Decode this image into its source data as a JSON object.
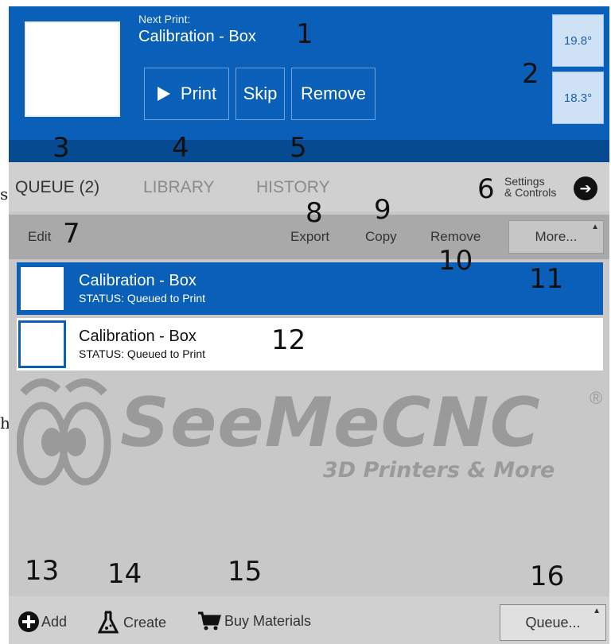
{
  "stray_glyphs": [
    "s",
    "h"
  ],
  "header": {
    "next_label": "Next Print:",
    "next_title": "Calibration - Box",
    "print_label": "Print",
    "skip_label": "Skip",
    "remove_label": "Remove",
    "temps": [
      "19.8°",
      "18.3°"
    ]
  },
  "tabs": {
    "queue": "QUEUE (2)",
    "library": "LIBRARY",
    "history": "HISTORY",
    "settings_line1": "Settings",
    "settings_line2": "& Controls"
  },
  "toolbar": {
    "edit": "Edit",
    "export": "Export",
    "copy": "Copy",
    "remove": "Remove",
    "more": "More..."
  },
  "queue": {
    "items": [
      {
        "title": "Calibration - Box",
        "status": "STATUS: Queued to Print",
        "selected": true
      },
      {
        "title": "Calibration - Box",
        "status": "STATUS: Queued to Print",
        "selected": false
      }
    ]
  },
  "logo": {
    "name": "SeeMeCNC",
    "reg": "®",
    "tagline": "3D Printers & More"
  },
  "bottom": {
    "add": "Add",
    "create": "Create",
    "buy": "Buy Materials",
    "queue_btn": "Queue..."
  },
  "callouts": [
    "1",
    "2",
    "3",
    "4",
    "5",
    "6",
    "7",
    "8",
    "9",
    "10",
    "11",
    "12",
    "13",
    "14",
    "15",
    "16"
  ],
  "colors": {
    "primary": "#0a5fb8",
    "primary_dark": "#064a91",
    "panel": "#c8c8c8",
    "toolbar": "#a9a9a9"
  }
}
